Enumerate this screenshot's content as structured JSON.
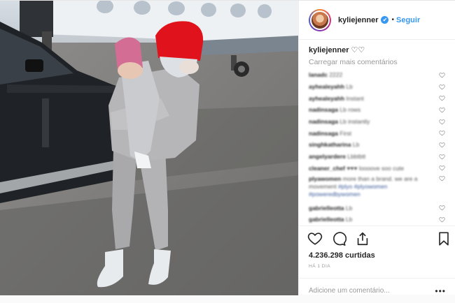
{
  "header": {
    "username": "kyliejenner",
    "verified_mark": "✔",
    "separator": "•",
    "follow_label": "Seguir"
  },
  "caption": {
    "username": "kyliejenner",
    "text": "♡♡"
  },
  "load_more_label": "Carregar mais comentários",
  "comments": [
    {
      "user": "lanadc",
      "text": "2222"
    },
    {
      "user": "ayhealeyahh",
      "text": "Lb"
    },
    {
      "user": "ayhealeyahh",
      "text": "Instant"
    },
    {
      "user": "nadinsaga",
      "text": "Lb rows"
    },
    {
      "user": "nadinsaga",
      "text": "Lb instantly"
    },
    {
      "user": "nadinsaga",
      "text": "First"
    },
    {
      "user": "singhkatharina",
      "text": "Lb"
    },
    {
      "user": "angelyardere",
      "text": "Lbbtbtt"
    },
    {
      "user": "cleaner_chef",
      "text": "♥♥♥ loooove soo cute"
    },
    {
      "user": "plyawomen",
      "text": "more than a brand. we are a movement",
      "link": "#plyo #plyowomen #poweredbywomen"
    },
    {
      "user": "gabrielleotta",
      "text": "Lb"
    },
    {
      "user": "gabrielleotta",
      "text": "Lb"
    }
  ],
  "actions": {
    "like_icon": "heart-icon",
    "comment_icon": "comment-icon",
    "share_icon": "share-icon",
    "save_icon": "bookmark-icon"
  },
  "likes_text": "4.236.298 curtidas",
  "time_ago": "HÁ 1 DIA",
  "add_comment_placeholder": "Adicione um comentário...",
  "more_options": "•••",
  "colors": {
    "link_blue": "#3897f0",
    "border": "#efefef",
    "muted": "#999999"
  }
}
